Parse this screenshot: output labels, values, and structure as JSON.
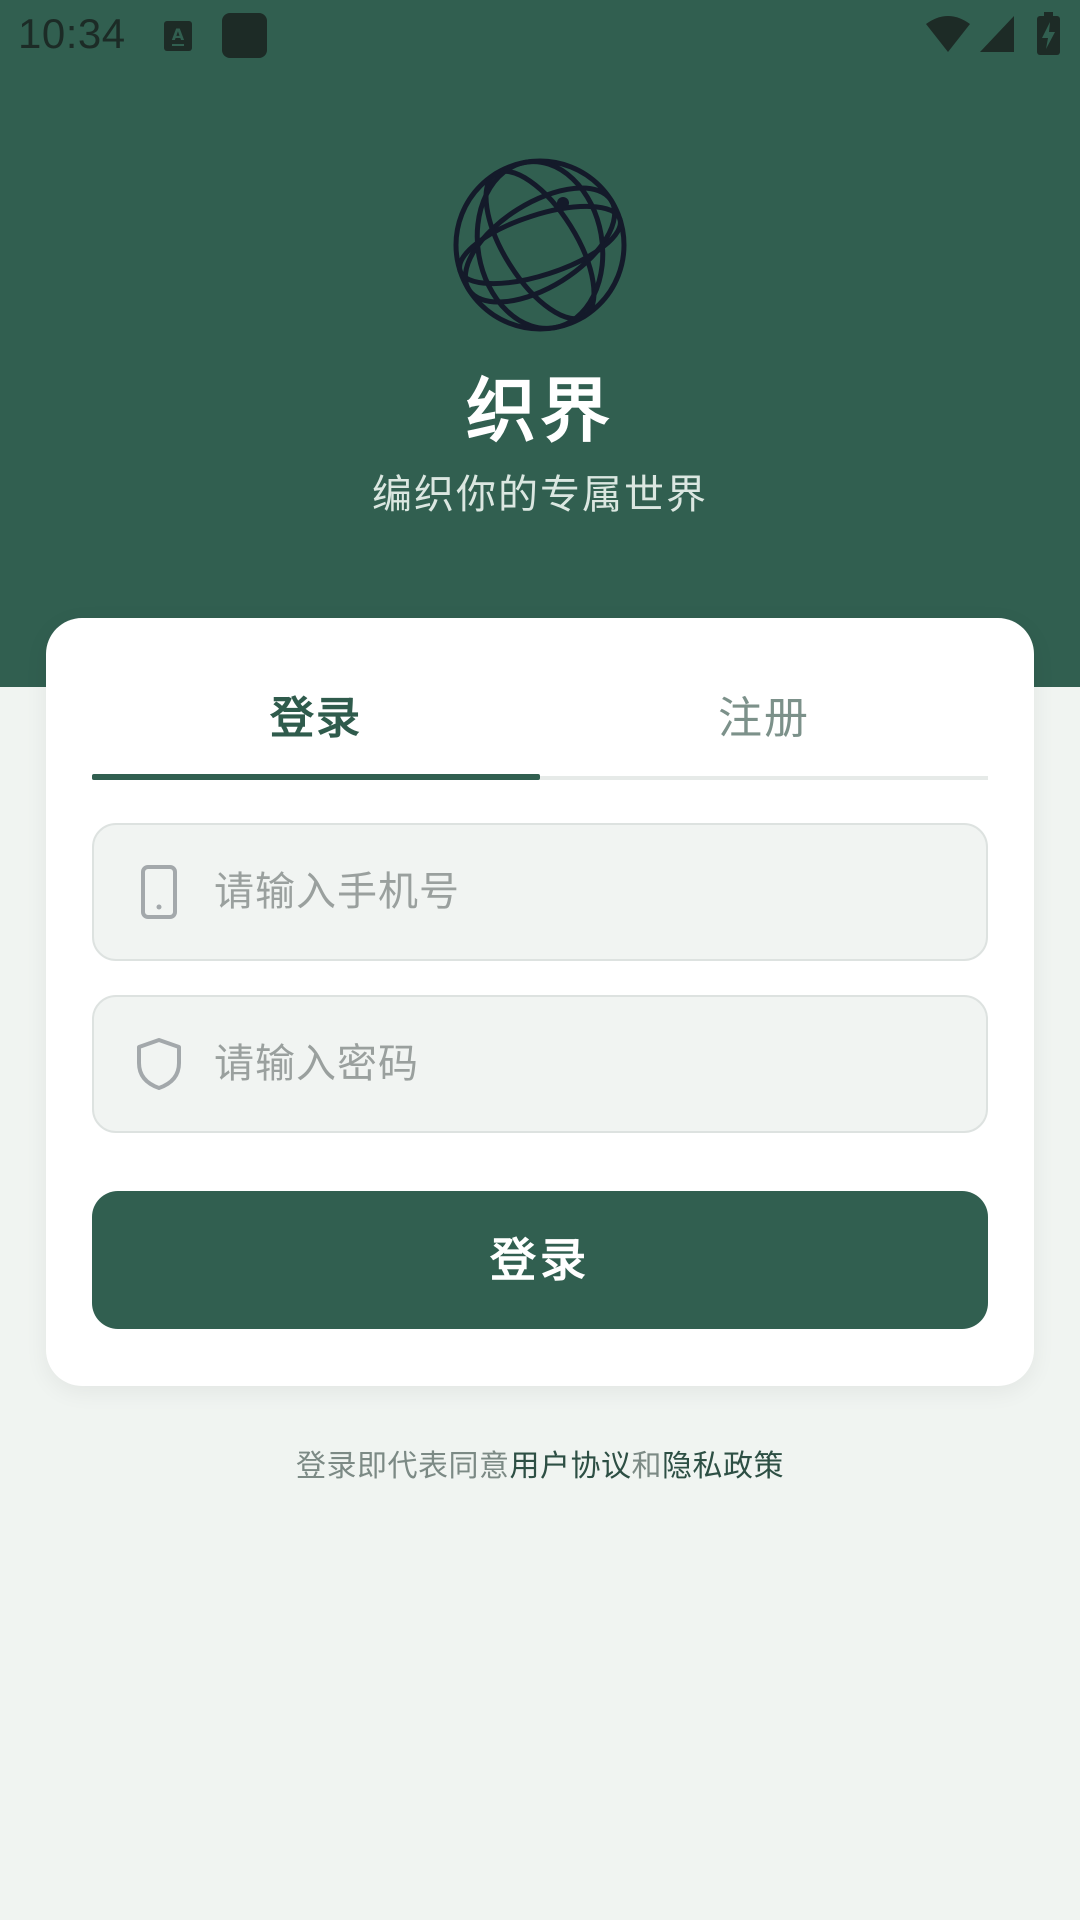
{
  "status_bar": {
    "time": "10:34"
  },
  "header": {
    "title": "织界",
    "subtitle": "编织你的专属世界"
  },
  "tabs": [
    {
      "label": "登录",
      "active": true
    },
    {
      "label": "注册",
      "active": false
    }
  ],
  "form": {
    "phone": {
      "placeholder": "请输入手机号",
      "value": "",
      "icon": "phone-icon"
    },
    "password": {
      "placeholder": "请输入密码",
      "value": "",
      "icon": "shield-icon"
    },
    "submit_label": "登录"
  },
  "agreement": {
    "prefix": "登录即代表同意",
    "user_agreement": "用户协议",
    "conjunction": "和",
    "privacy_policy": "隐私政策"
  },
  "colors": {
    "primary": "#315f50",
    "background": "#f0f4f1",
    "card": "#ffffff",
    "muted_text": "#7c918a"
  }
}
